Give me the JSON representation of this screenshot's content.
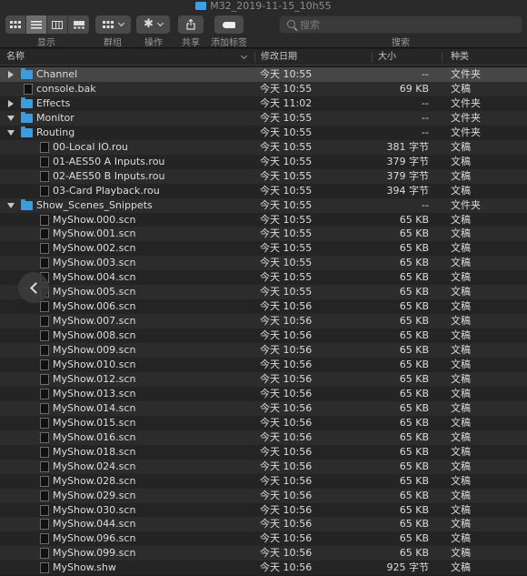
{
  "window": {
    "title": "M32_2019-11-15_10h55"
  },
  "toolbar": {
    "display_label": "显示",
    "group_label": "群组",
    "action_label": "操作",
    "share_label": "共享",
    "tags_label": "添加标签",
    "search_label": "搜索"
  },
  "search": {
    "placeholder": "搜索"
  },
  "columns": {
    "name": "名称",
    "date": "修改日期",
    "size": "大小",
    "kind": "种类"
  },
  "rows": [
    {
      "name": "Channel",
      "date": "今天 10:55",
      "size": "--",
      "kind": "文件夹",
      "type": "folder",
      "depth": 0,
      "disclosure": "closed"
    },
    {
      "name": "console.bak",
      "date": "今天 10:55",
      "size": "69 KB",
      "kind": "文稿",
      "type": "doc",
      "depth": 0
    },
    {
      "name": "Effects",
      "date": "今天 11:02",
      "size": "--",
      "kind": "文件夹",
      "type": "folder",
      "depth": 0,
      "disclosure": "closed"
    },
    {
      "name": "Monitor",
      "date": "今天 10:55",
      "size": "--",
      "kind": "文件夹",
      "type": "folder",
      "depth": 0,
      "disclosure": "open"
    },
    {
      "name": "Routing",
      "date": "今天 10:55",
      "size": "--",
      "kind": "文件夹",
      "type": "folder",
      "depth": 0,
      "disclosure": "open"
    },
    {
      "name": "00-Local IO.rou",
      "date": "今天 10:55",
      "size": "381 字节",
      "kind": "文稿",
      "type": "doc",
      "depth": 1
    },
    {
      "name": "01-AES50 A Inputs.rou",
      "date": "今天 10:55",
      "size": "379 字节",
      "kind": "文稿",
      "type": "doc",
      "depth": 1
    },
    {
      "name": "02-AES50 B Inputs.rou",
      "date": "今天 10:55",
      "size": "379 字节",
      "kind": "文稿",
      "type": "doc",
      "depth": 1
    },
    {
      "name": "03-Card Playback.rou",
      "date": "今天 10:55",
      "size": "394 字节",
      "kind": "文稿",
      "type": "doc",
      "depth": 1
    },
    {
      "name": "Show_Scenes_Snippets",
      "date": "今天 10:55",
      "size": "--",
      "kind": "文件夹",
      "type": "folder",
      "depth": 0,
      "disclosure": "open"
    },
    {
      "name": "MyShow.000.scn",
      "date": "今天 10:55",
      "size": "65 KB",
      "kind": "文稿",
      "type": "doc",
      "depth": 1
    },
    {
      "name": "MyShow.001.scn",
      "date": "今天 10:55",
      "size": "65 KB",
      "kind": "文稿",
      "type": "doc",
      "depth": 1
    },
    {
      "name": "MyShow.002.scn",
      "date": "今天 10:55",
      "size": "65 KB",
      "kind": "文稿",
      "type": "doc",
      "depth": 1
    },
    {
      "name": "MyShow.003.scn",
      "date": "今天 10:55",
      "size": "65 KB",
      "kind": "文稿",
      "type": "doc",
      "depth": 1
    },
    {
      "name": "MyShow.004.scn",
      "date": "今天 10:55",
      "size": "65 KB",
      "kind": "文稿",
      "type": "doc",
      "depth": 1
    },
    {
      "name": "MyShow.005.scn",
      "date": "今天 10:55",
      "size": "65 KB",
      "kind": "文稿",
      "type": "doc",
      "depth": 1
    },
    {
      "name": "MyShow.006.scn",
      "date": "今天 10:56",
      "size": "65 KB",
      "kind": "文稿",
      "type": "doc",
      "depth": 1
    },
    {
      "name": "MyShow.007.scn",
      "date": "今天 10:56",
      "size": "65 KB",
      "kind": "文稿",
      "type": "doc",
      "depth": 1
    },
    {
      "name": "MyShow.008.scn",
      "date": "今天 10:56",
      "size": "65 KB",
      "kind": "文稿",
      "type": "doc",
      "depth": 1
    },
    {
      "name": "MyShow.009.scn",
      "date": "今天 10:56",
      "size": "65 KB",
      "kind": "文稿",
      "type": "doc",
      "depth": 1
    },
    {
      "name": "MyShow.010.scn",
      "date": "今天 10:56",
      "size": "65 KB",
      "kind": "文稿",
      "type": "doc",
      "depth": 1
    },
    {
      "name": "MyShow.012.scn",
      "date": "今天 10:56",
      "size": "65 KB",
      "kind": "文稿",
      "type": "doc",
      "depth": 1
    },
    {
      "name": "MyShow.013.scn",
      "date": "今天 10:56",
      "size": "65 KB",
      "kind": "文稿",
      "type": "doc",
      "depth": 1
    },
    {
      "name": "MyShow.014.scn",
      "date": "今天 10:56",
      "size": "65 KB",
      "kind": "文稿",
      "type": "doc",
      "depth": 1
    },
    {
      "name": "MyShow.015.scn",
      "date": "今天 10:56",
      "size": "65 KB",
      "kind": "文稿",
      "type": "doc",
      "depth": 1
    },
    {
      "name": "MyShow.016.scn",
      "date": "今天 10:56",
      "size": "65 KB",
      "kind": "文稿",
      "type": "doc",
      "depth": 1
    },
    {
      "name": "MyShow.018.scn",
      "date": "今天 10:56",
      "size": "65 KB",
      "kind": "文稿",
      "type": "doc",
      "depth": 1
    },
    {
      "name": "MyShow.024.scn",
      "date": "今天 10:56",
      "size": "65 KB",
      "kind": "文稿",
      "type": "doc",
      "depth": 1
    },
    {
      "name": "MyShow.028.scn",
      "date": "今天 10:56",
      "size": "65 KB",
      "kind": "文稿",
      "type": "doc",
      "depth": 1
    },
    {
      "name": "MyShow.029.scn",
      "date": "今天 10:56",
      "size": "65 KB",
      "kind": "文稿",
      "type": "doc",
      "depth": 1
    },
    {
      "name": "MyShow.030.scn",
      "date": "今天 10:56",
      "size": "65 KB",
      "kind": "文稿",
      "type": "doc",
      "depth": 1
    },
    {
      "name": "MyShow.044.scn",
      "date": "今天 10:56",
      "size": "65 KB",
      "kind": "文稿",
      "type": "doc",
      "depth": 1
    },
    {
      "name": "MyShow.096.scn",
      "date": "今天 10:56",
      "size": "65 KB",
      "kind": "文稿",
      "type": "doc",
      "depth": 1
    },
    {
      "name": "MyShow.099.scn",
      "date": "今天 10:56",
      "size": "65 KB",
      "kind": "文稿",
      "type": "doc",
      "depth": 1
    },
    {
      "name": "MyShow.shw",
      "date": "今天 10:56",
      "size": "925 字节",
      "kind": "文稿",
      "type": "doc",
      "depth": 1
    }
  ],
  "colors": {
    "folder": "#3a9de0",
    "background": "#1e1e1e",
    "row_alt": "#2c2c2c"
  },
  "icons": {
    "back": "chevron-left-icon"
  }
}
